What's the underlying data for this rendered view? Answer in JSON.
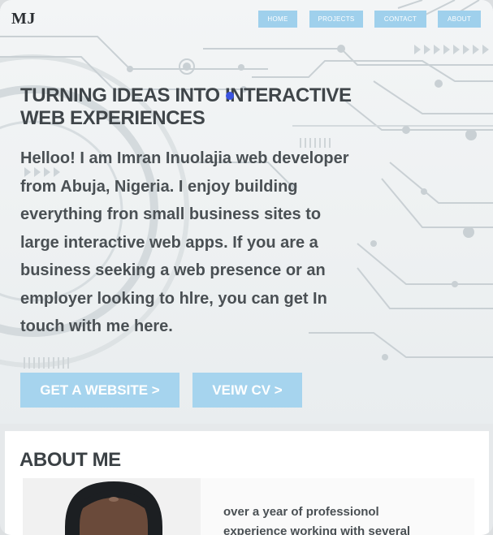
{
  "logo": "MJ",
  "nav": {
    "items": [
      "HOME",
      "PROJECTS",
      "CONTACT",
      "ABOUT"
    ]
  },
  "hero": {
    "headline_line1": "TURNING IDEAS INTO INTERACTIVE",
    "headline_line2": "WEB EXPERIENCES",
    "intro_lines": [
      "Helloo! I am Imran Inuolajia web developer",
      "from Abuja, Nigeria. I enjoy building",
      "everything fron small business sites to",
      "large interactive web apps. If you are a",
      "business seeking a web presence or an",
      "employer looking to hlre, you can get In",
      "touch with me here."
    ],
    "cta_primary": "GET A WEBSITE >",
    "cta_secondary": "VEIW CV >"
  },
  "about": {
    "title": "ABOUT ME",
    "text_line1": "over a year of professionol",
    "text_line2": "experience working with several"
  },
  "colors": {
    "accent": "#a6d4ee",
    "text": "#3f4549"
  }
}
